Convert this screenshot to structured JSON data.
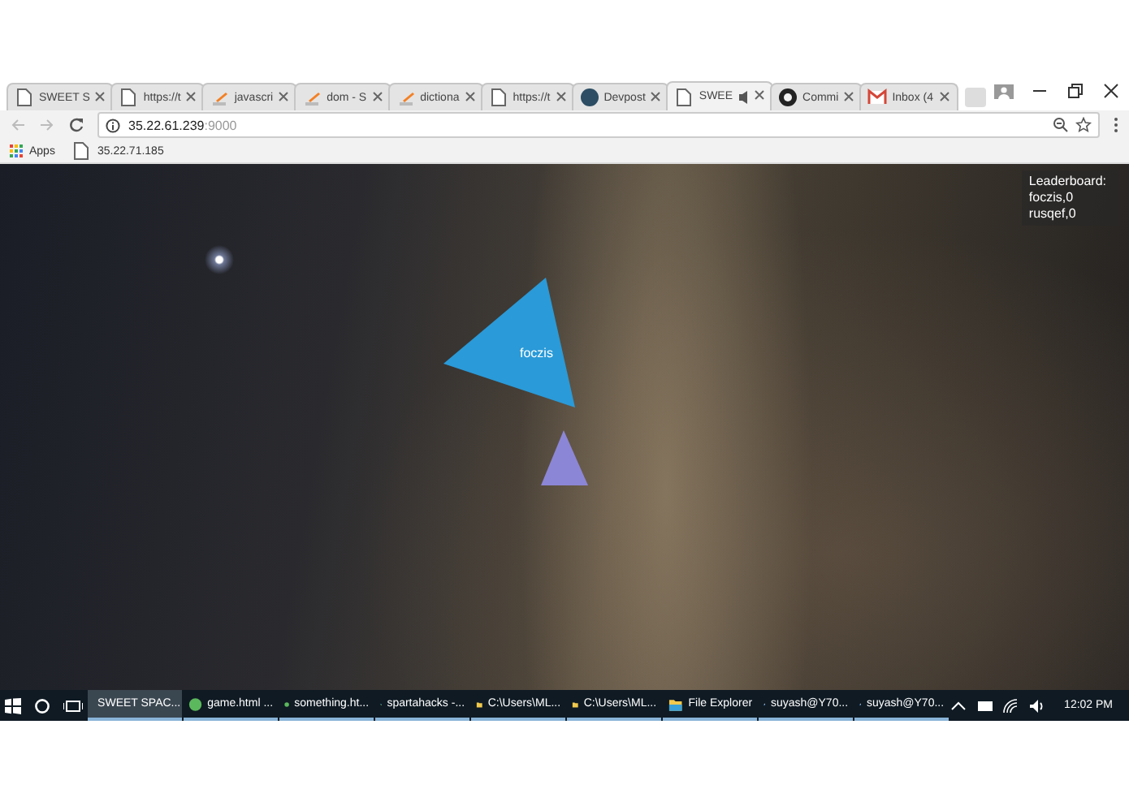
{
  "browser": {
    "tabs": [
      {
        "title": "SWEET S",
        "kind": "page",
        "selected": false
      },
      {
        "title": "https://t",
        "kind": "page",
        "selected": false
      },
      {
        "title": "javascri",
        "kind": "stack",
        "selected": false
      },
      {
        "title": "dom - S",
        "kind": "stack",
        "selected": false
      },
      {
        "title": "dictiona",
        "kind": "stack",
        "selected": false
      },
      {
        "title": "https://t",
        "kind": "page",
        "selected": false
      },
      {
        "title": "Devpost",
        "kind": "devpost",
        "selected": false
      },
      {
        "title": "SWEE",
        "kind": "page",
        "selected": true,
        "audio": true
      },
      {
        "title": "Commi",
        "kind": "github",
        "selected": false
      },
      {
        "title": "Inbox (4",
        "kind": "mail",
        "selected": false
      }
    ],
    "address": {
      "host": "35.22.61.239",
      "port": ":9000"
    },
    "bookmarks": [
      {
        "label": "Apps",
        "kind": "apps"
      },
      {
        "label": "35.22.71.185",
        "kind": "page"
      }
    ]
  },
  "game": {
    "leaderboard": {
      "title": "Leaderboard:",
      "entries": [
        "foczis,0",
        "rusqef,0"
      ]
    },
    "players": [
      {
        "kind": "named",
        "name": "foczis",
        "color": "#2a9ad8"
      },
      {
        "kind": "ghost",
        "color": "#8c86d6"
      }
    ]
  },
  "taskbar": {
    "items": [
      {
        "label": "SWEET SPAC...",
        "kind": "chrome",
        "selected": true
      },
      {
        "label": "game.html ...",
        "kind": "globe",
        "selected": false
      },
      {
        "label": "something.ht...",
        "kind": "globe",
        "selected": false
      },
      {
        "label": "spartahacks -...",
        "kind": "app",
        "selected": false
      },
      {
        "label": "C:\\Users\\ML...",
        "kind": "folder",
        "selected": false
      },
      {
        "label": "C:\\Users\\ML...",
        "kind": "folder",
        "selected": false
      },
      {
        "label": "File Explorer",
        "kind": "explorer",
        "selected": false
      },
      {
        "label": "suyash@Y70...",
        "kind": "terminal",
        "selected": false
      },
      {
        "label": "suyash@Y70...",
        "kind": "terminal",
        "selected": false
      }
    ],
    "clock": "12:02 PM"
  }
}
